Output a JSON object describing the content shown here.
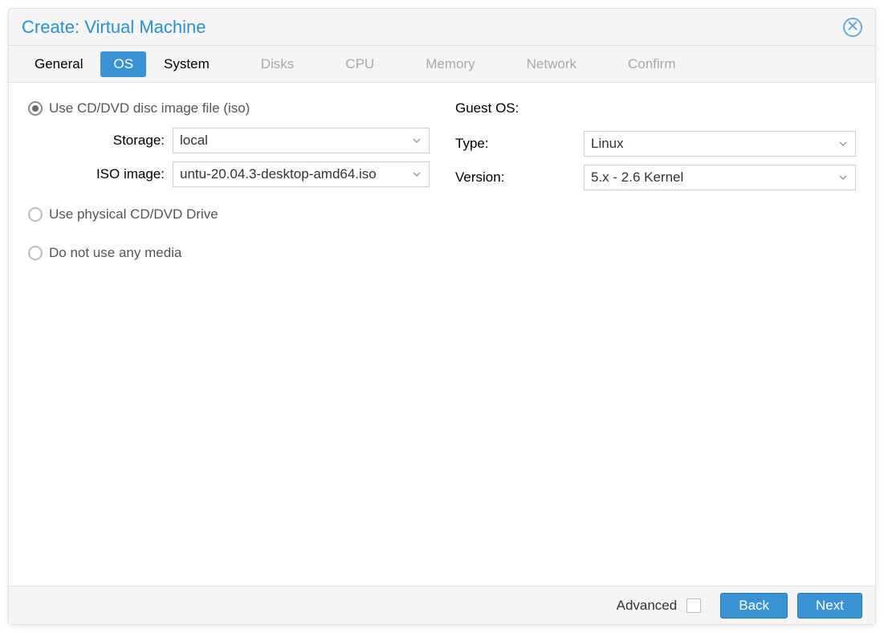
{
  "title": "Create: Virtual Machine",
  "tabs": {
    "general": "General",
    "os": "OS",
    "system": "System",
    "disks": "Disks",
    "cpu": "CPU",
    "memory": "Memory",
    "network": "Network",
    "confirm": "Confirm"
  },
  "left": {
    "radio_iso": "Use CD/DVD disc image file (iso)",
    "storage_label": "Storage:",
    "storage_value": "local",
    "iso_label": "ISO image:",
    "iso_value": "untu-20.04.3-desktop-amd64.iso",
    "radio_physical": "Use physical CD/DVD Drive",
    "radio_none": "Do not use any media"
  },
  "right": {
    "heading": "Guest OS:",
    "type_label": "Type:",
    "type_value": "Linux",
    "version_label": "Version:",
    "version_value": "5.x - 2.6 Kernel"
  },
  "footer": {
    "advanced": "Advanced",
    "back": "Back",
    "next": "Next"
  }
}
